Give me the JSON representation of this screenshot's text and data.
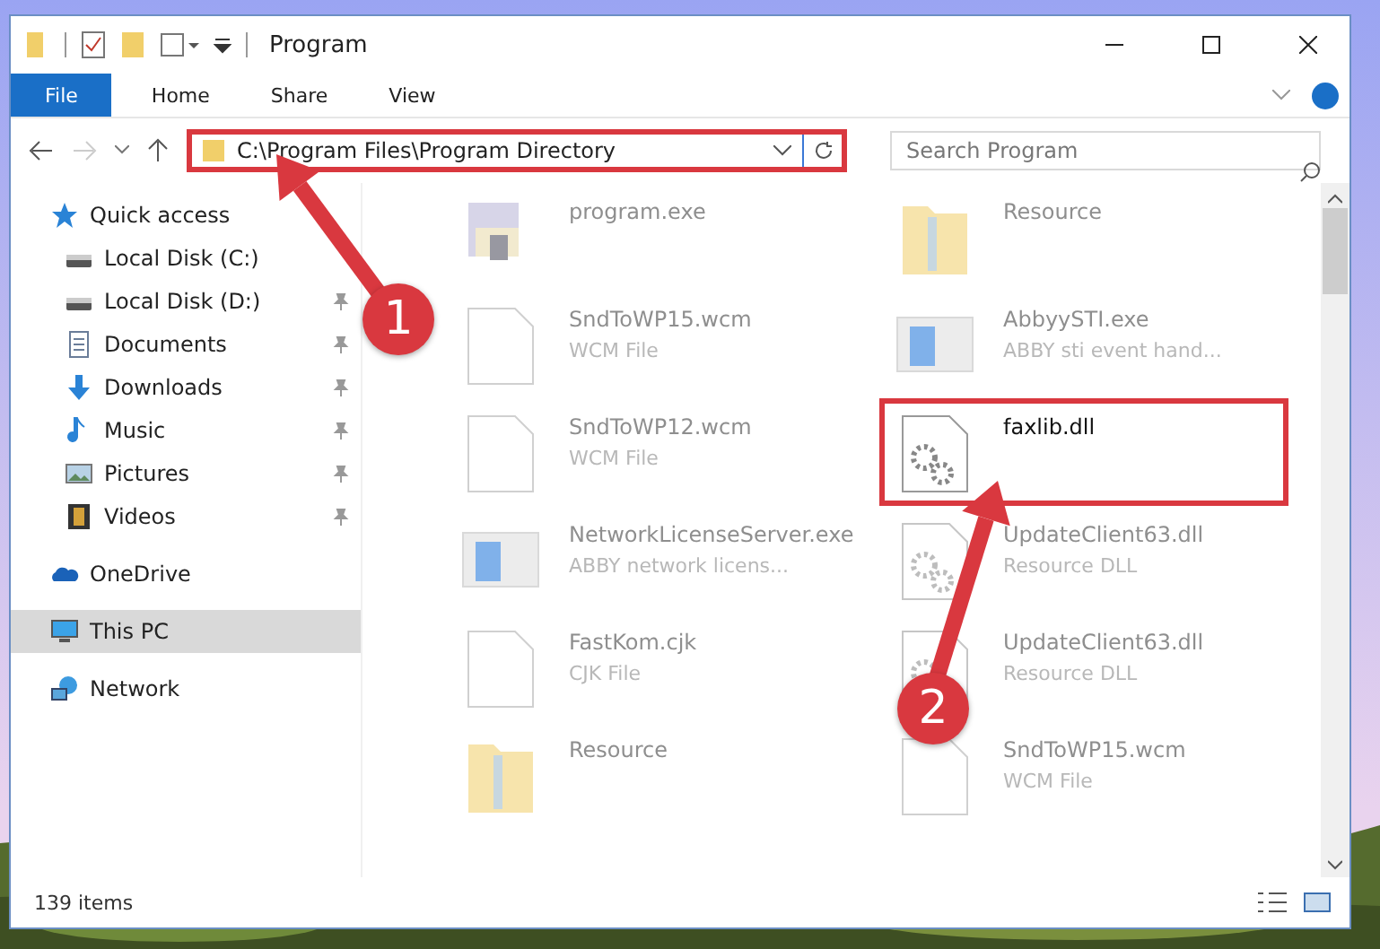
{
  "window": {
    "title": "Program"
  },
  "ribbon": {
    "tabs": [
      {
        "label": "File",
        "kind": "app"
      },
      {
        "label": "Home",
        "kind": "tab"
      },
      {
        "label": "Share",
        "kind": "tab"
      },
      {
        "label": "View",
        "kind": "tab"
      }
    ]
  },
  "address": {
    "path": "C:\\Program Files\\Program Directory",
    "highlighted": true
  },
  "search": {
    "placeholder": "Search Program"
  },
  "sidebar": {
    "items": [
      {
        "label": "Quick access",
        "kind": "star",
        "selected": false,
        "children": [
          {
            "label": "Local Disk (C:)",
            "kind": "drive",
            "pinned": false
          },
          {
            "label": "Local Disk (D:)",
            "kind": "drive",
            "pinned": true
          },
          {
            "label": "Documents",
            "kind": "document",
            "pinned": true
          },
          {
            "label": "Downloads",
            "kind": "download",
            "pinned": true
          },
          {
            "label": "Music",
            "kind": "music",
            "pinned": true
          },
          {
            "label": "Pictures",
            "kind": "picture",
            "pinned": true
          },
          {
            "label": "Videos",
            "kind": "video",
            "pinned": true
          }
        ]
      },
      {
        "label": "OneDrive",
        "kind": "cloud",
        "selected": false
      },
      {
        "label": "This PC",
        "kind": "pc",
        "selected": true
      },
      {
        "label": "Network",
        "kind": "network",
        "selected": false
      }
    ]
  },
  "files": [
    {
      "name": "program.exe",
      "kind": "exe",
      "faded": true,
      "highlighted": false
    },
    {
      "name": "Resource",
      "kind": "folder",
      "faded": true,
      "highlighted": false
    },
    {
      "name": "SndToWP15.wcm",
      "type": "WCM File",
      "kind": "file",
      "faded": true,
      "highlighted": false
    },
    {
      "name": "AbbyySTI.exe",
      "type": "ABBY sti event hand...",
      "kind": "app",
      "faded": true,
      "highlighted": false
    },
    {
      "name": "SndToWP12.wcm",
      "type": "WCM File",
      "kind": "file",
      "faded": true,
      "highlighted": false
    },
    {
      "name": "faxlib.dll",
      "kind": "dll",
      "faded": false,
      "highlighted": true
    },
    {
      "name": "NetworkLicenseServer.exe",
      "type": "ABBY network licens...",
      "kind": "app",
      "faded": true,
      "highlighted": false
    },
    {
      "name": "UpdateClient63.dll",
      "type": "Resource DLL",
      "kind": "dll",
      "faded": true,
      "highlighted": false
    },
    {
      "name": "FastKom.cjk",
      "type": "CJK File",
      "kind": "file",
      "faded": true,
      "highlighted": false
    },
    {
      "name": "UpdateClient63.dll",
      "type": "Resource DLL",
      "kind": "dll",
      "faded": true,
      "highlighted": false
    },
    {
      "name": "Resource",
      "kind": "folder",
      "faded": true,
      "highlighted": false
    },
    {
      "name": "SndToWP15.wcm",
      "type": "WCM File",
      "kind": "file",
      "faded": true,
      "highlighted": false
    }
  ],
  "status_bar": {
    "count": "139 items"
  },
  "annotations": [
    {
      "number": "1"
    },
    {
      "number": "2"
    }
  ]
}
